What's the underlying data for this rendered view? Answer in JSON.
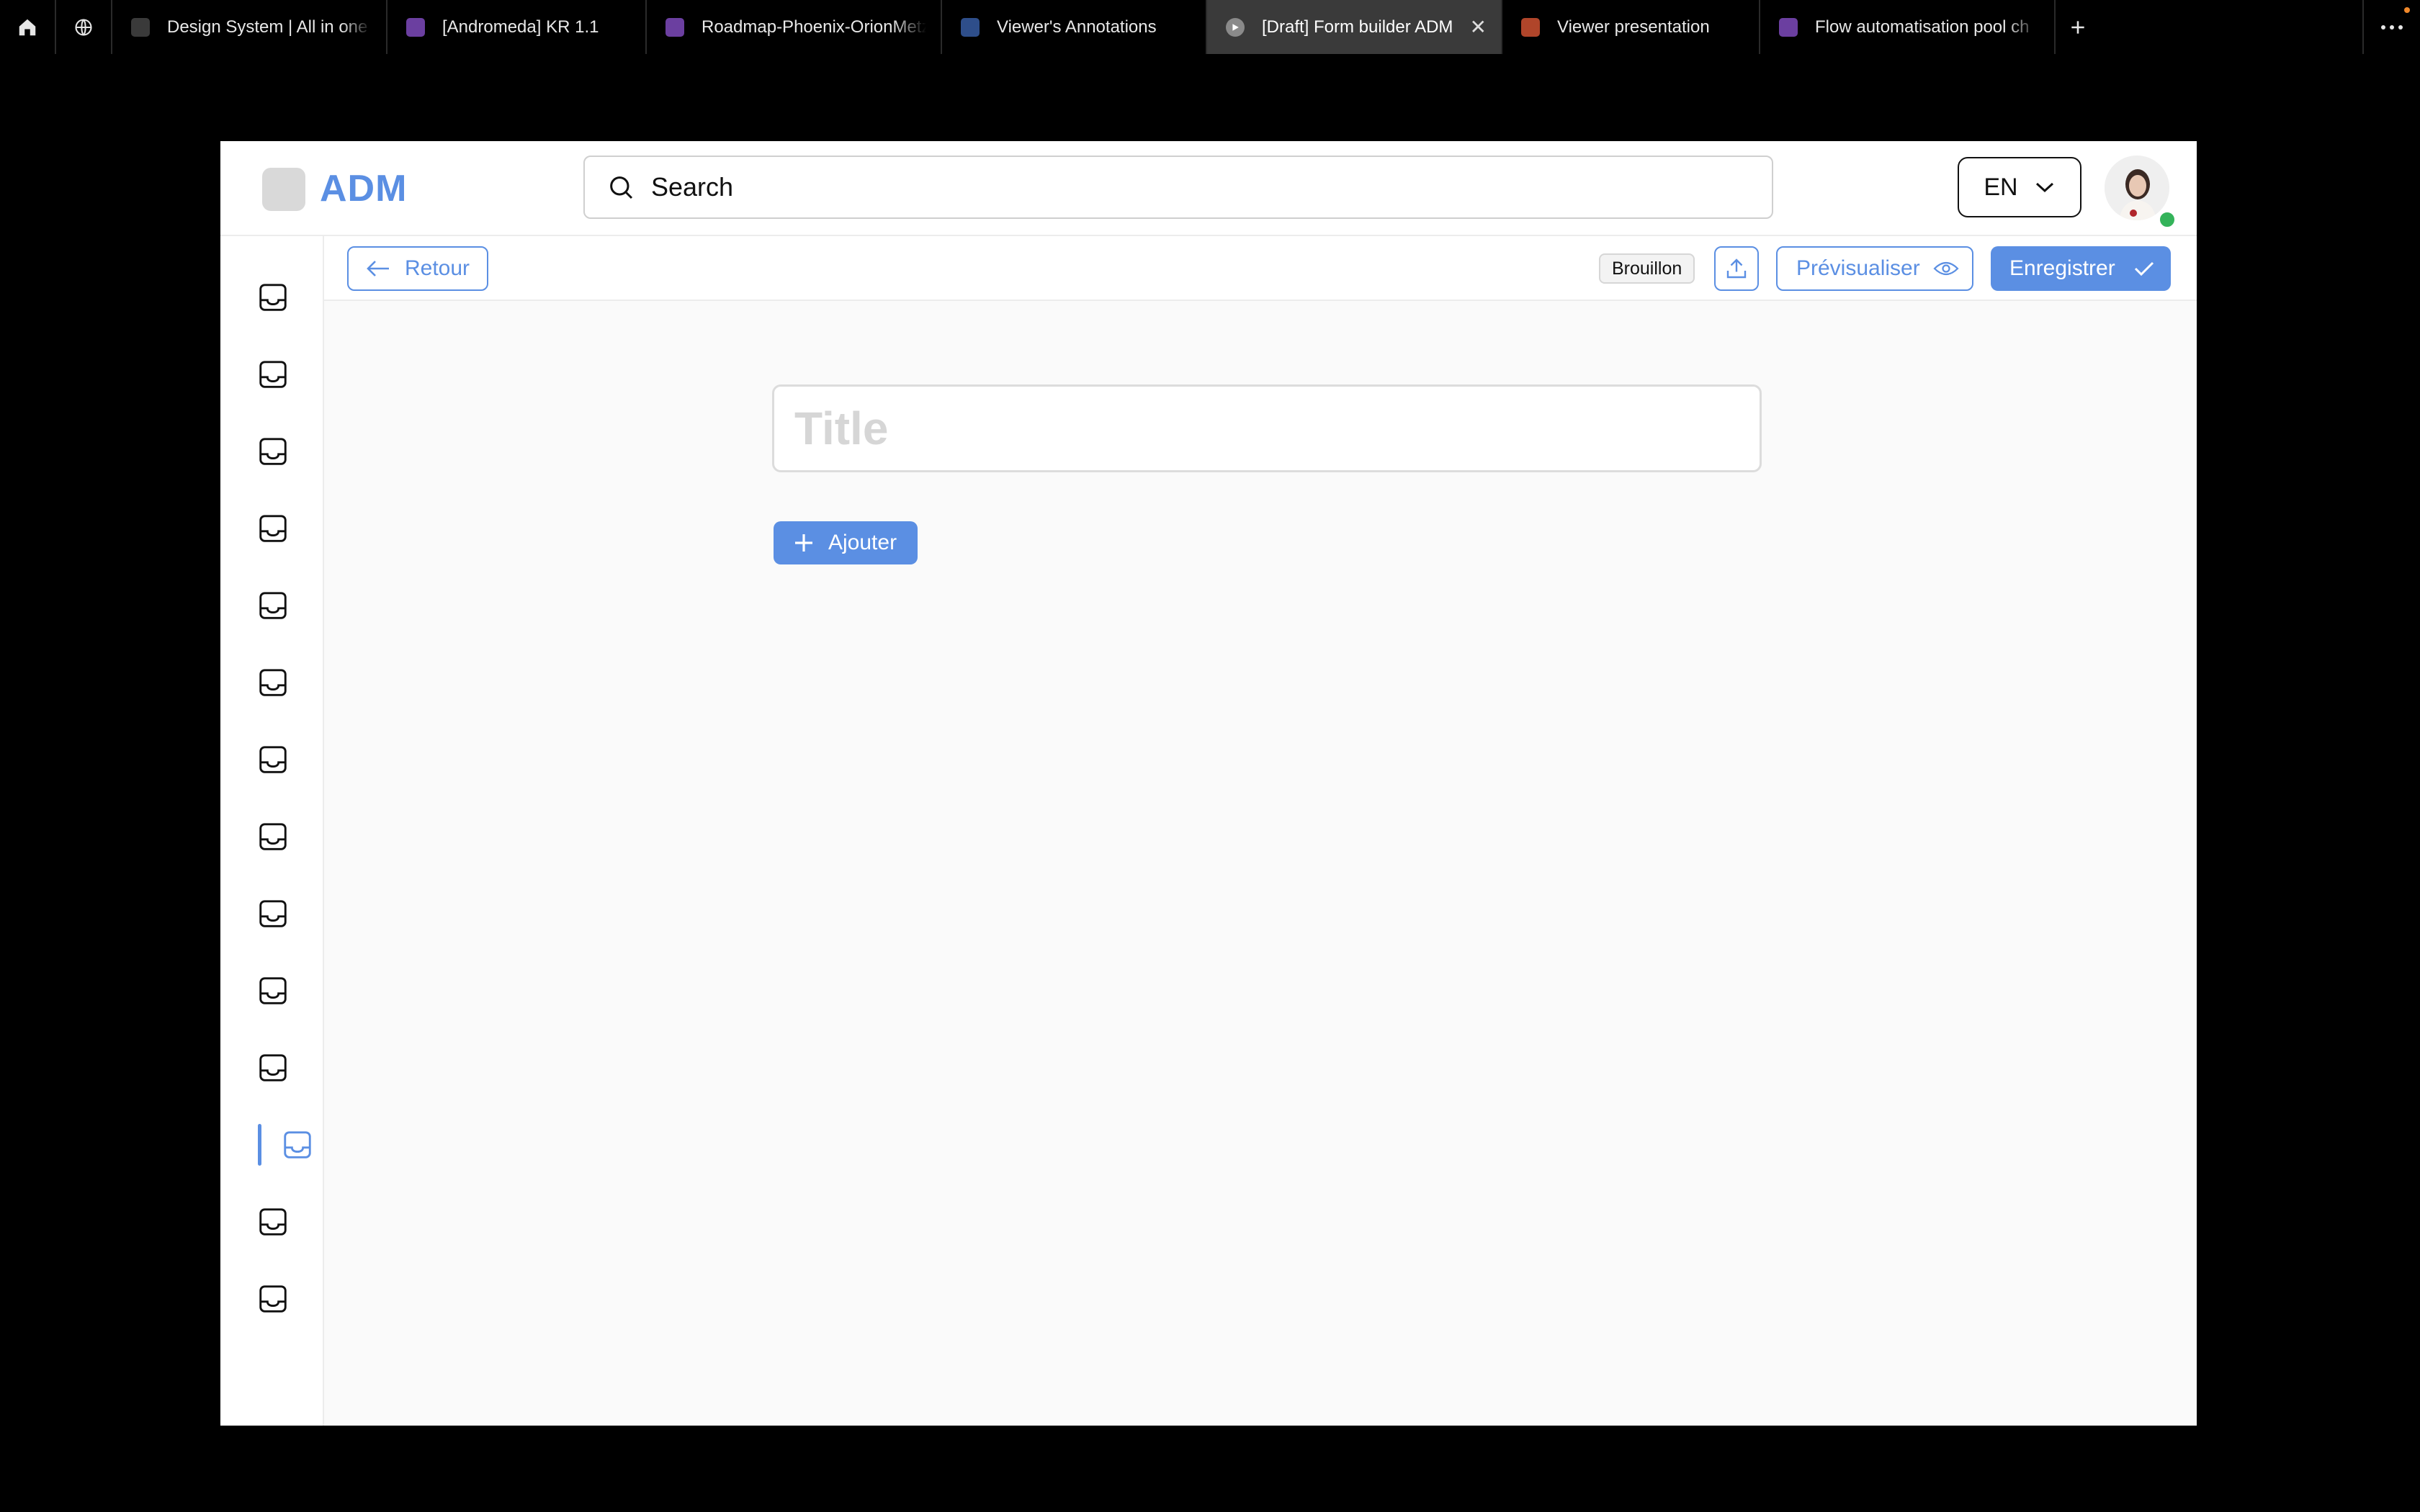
{
  "browser": {
    "tabs": [
      {
        "title": "Design System | All in one pl",
        "favicon_color": "#3a3a3a",
        "active": false
      },
      {
        "title": "[Andromeda] KR 1.1",
        "favicon_color": "#6b3fa0",
        "active": false
      },
      {
        "title": "Roadmap-Phoenix-OrionMetz",
        "favicon_color": "#6b3fa0",
        "active": false
      },
      {
        "title": "Viewer's Annotations",
        "favicon_color": "#2e4e8a",
        "active": false
      },
      {
        "title": "[Draft] Form builder ADM",
        "favicon_color": "#8a8a8a",
        "active": true
      },
      {
        "title": "Viewer presentation",
        "favicon_color": "#b0452a",
        "active": false
      },
      {
        "title": "Flow automatisation pool ch",
        "favicon_color": "#6b3fa0",
        "active": false
      }
    ],
    "close_glyph": "✕",
    "new_tab_icon": "plus-icon",
    "more_icon": "more-horizontal-icon"
  },
  "app": {
    "logo_text": "ADM",
    "search": {
      "placeholder": "Search",
      "value": ""
    },
    "language": "EN",
    "user_online": true,
    "sidebar": {
      "item_icon": "inbox-icon",
      "item_count": 14,
      "active_index": 11
    },
    "toolbar": {
      "back_label": "Retour",
      "status_badge": "Brouillon",
      "preview_label": "Prévisualiser",
      "save_label": "Enregistrer"
    },
    "form": {
      "title_placeholder": "Title",
      "title_value": "",
      "add_label": "Ajouter"
    }
  },
  "colors": {
    "accent": "#5b8fe3",
    "online": "#34b35a",
    "background": "#fafafa"
  }
}
